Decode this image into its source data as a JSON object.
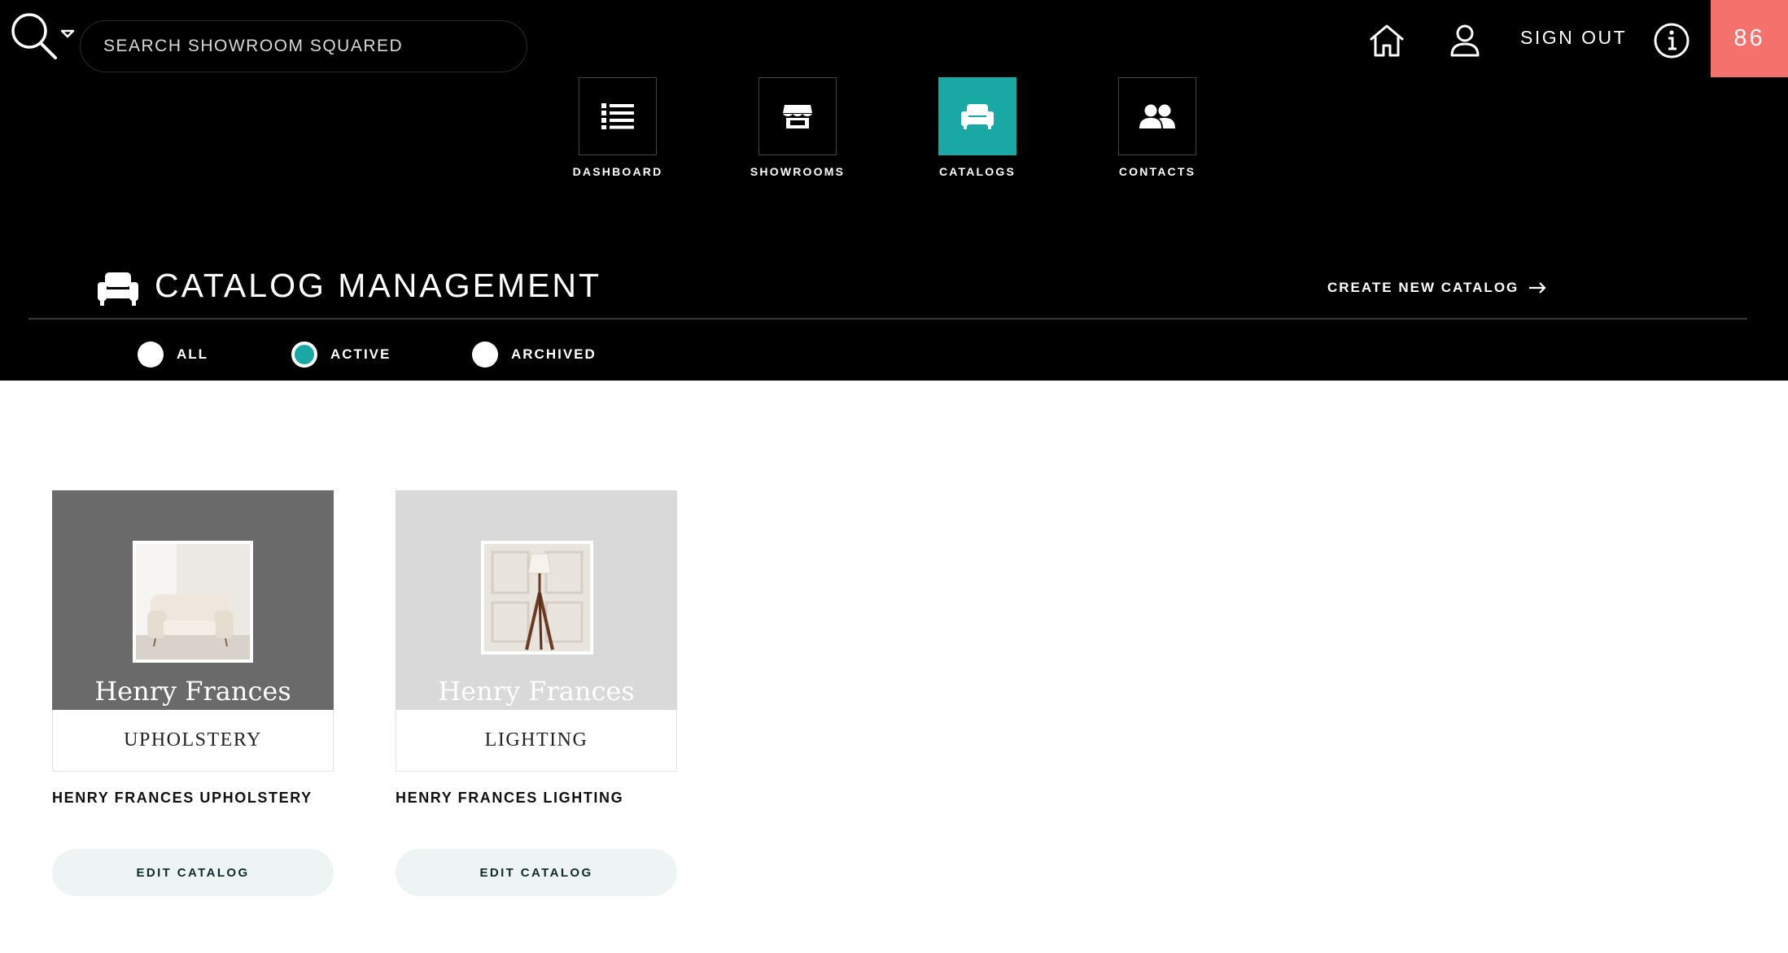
{
  "search": {
    "placeholder": "SEARCH SHOWROOM SQUARED"
  },
  "top": {
    "sign_out": "SIGN OUT",
    "badge": "86"
  },
  "nav": [
    {
      "label": "DASHBOARD",
      "icon": "list-icon"
    },
    {
      "label": "SHOWROOMS",
      "icon": "storefront-icon"
    },
    {
      "label": "CATALOGS",
      "icon": "armchair-icon",
      "active": true
    },
    {
      "label": "CONTACTS",
      "icon": "people-icon"
    }
  ],
  "page": {
    "title": "CATALOG MANAGEMENT",
    "create_link": "CREATE NEW CATALOG"
  },
  "filters": [
    {
      "label": "ALL",
      "checked": false
    },
    {
      "label": "ACTIVE",
      "checked": true
    },
    {
      "label": "ARCHIVED",
      "checked": false
    }
  ],
  "catalogs": [
    {
      "brand": "Henry Frances",
      "subtitle": "UPHOLSTERY",
      "name": "HENRY FRANCES UPHOLSTERY",
      "button": "EDIT CATALOG",
      "thumb_bg": "#6b6a6a"
    },
    {
      "brand": "Henry Frances",
      "subtitle": "LIGHTING",
      "name": "HENRY FRANCES LIGHTING",
      "button": "EDIT CATALOG",
      "thumb_bg": "#d9d9d9"
    }
  ],
  "colors": {
    "accent": "#1aa8a4",
    "badge": "#f4716c",
    "header": "#000000"
  }
}
